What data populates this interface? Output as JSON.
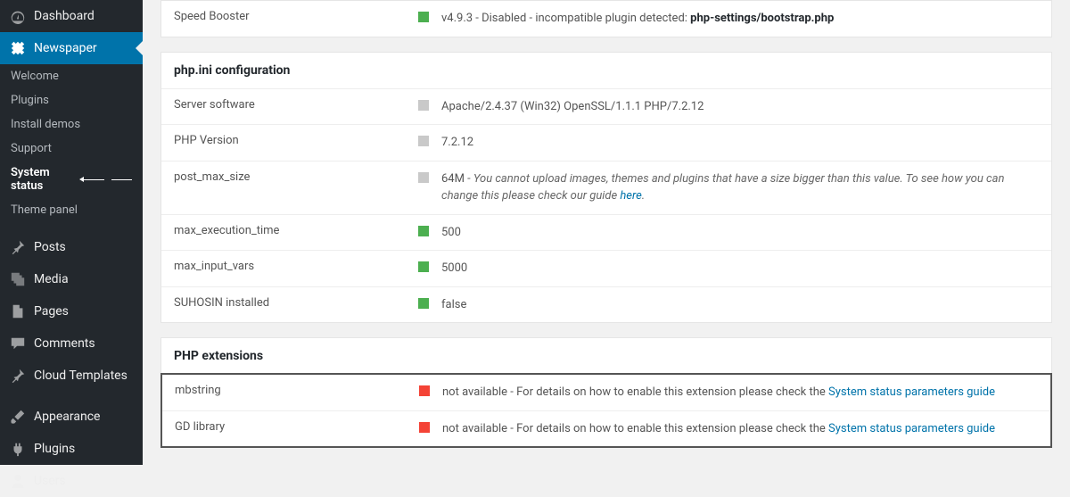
{
  "sidebar": {
    "dashboard": "Dashboard",
    "newspaper": "Newspaper",
    "sub": {
      "welcome": "Welcome",
      "plugins": "Plugins",
      "install_demos": "Install demos",
      "support": "Support",
      "system_status": "System status",
      "theme_panel": "Theme panel"
    },
    "posts": "Posts",
    "media": "Media",
    "pages": "Pages",
    "comments": "Comments",
    "cloud_templates": "Cloud Templates",
    "appearance": "Appearance",
    "plugins_main": "Plugins",
    "users": "Users"
  },
  "top": {
    "label": "Speed Booster",
    "value_pre": "v4.9.3 - Disabled - incompatible plugin detected: ",
    "value_bold": "php-settings/bootstrap.php"
  },
  "php": {
    "heading": "php.ini configuration",
    "server_label": "Server software",
    "server_value": "Apache/2.4.37 (Win32) OpenSSL/1.1.1 PHP/7.2.12",
    "version_label": "PHP Version",
    "version_value": "7.2.12",
    "postmax_label": "post_max_size",
    "postmax_value": "64M",
    "postmax_note": " - You cannot upload images, themes and plugins that have a size bigger than this value. To see how you can change this please check our guide ",
    "postmax_link": "here",
    "postmax_dot": ".",
    "exec_label": "max_execution_time",
    "exec_value": "500",
    "input_label": "max_input_vars",
    "input_value": "5000",
    "suhosin_label": "SUHOSIN installed",
    "suhosin_value": "false"
  },
  "ext": {
    "heading": "PHP extensions",
    "mb_label": "mbstring",
    "mb_value": "not available - For details on how to enable this extension please check the ",
    "mb_link": "System status parameters guide",
    "gd_label": "GD library",
    "gd_value": "not available - For details on how to enable this extension please check the ",
    "gd_link": "System status parameters guide"
  }
}
